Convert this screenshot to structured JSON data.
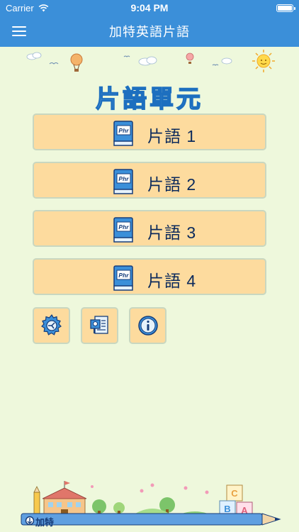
{
  "status_bar": {
    "carrier": "Carrier",
    "time": "9:04 PM"
  },
  "nav": {
    "title": "加特英語片語",
    "menu_icon": "hamburger-menu-icon"
  },
  "section": {
    "title": "片語單元"
  },
  "units": [
    {
      "label": "片語 1",
      "icon": "phrase-book-icon",
      "icon_text": "Phr"
    },
    {
      "label": "片語 2",
      "icon": "phrase-book-icon",
      "icon_text": "Phr"
    },
    {
      "label": "片語 3",
      "icon": "phrase-book-icon",
      "icon_text": "Phr"
    },
    {
      "label": "片語 4",
      "icon": "phrase-book-icon",
      "icon_text": "Phr"
    }
  ],
  "tools": [
    {
      "icon": "settings-gear-icon"
    },
    {
      "icon": "document-search-icon"
    },
    {
      "icon": "info-icon"
    }
  ],
  "footer": {
    "brand": "加特"
  },
  "colors": {
    "primary_blue": "#3b8fd9",
    "background": "#eef8dc",
    "button_fill": "#fddb9e",
    "button_border": "#c9d7c0",
    "label_text": "#0b2a5c",
    "title_fill": "#b6e1ff",
    "title_stroke": "#1d6fbf"
  }
}
